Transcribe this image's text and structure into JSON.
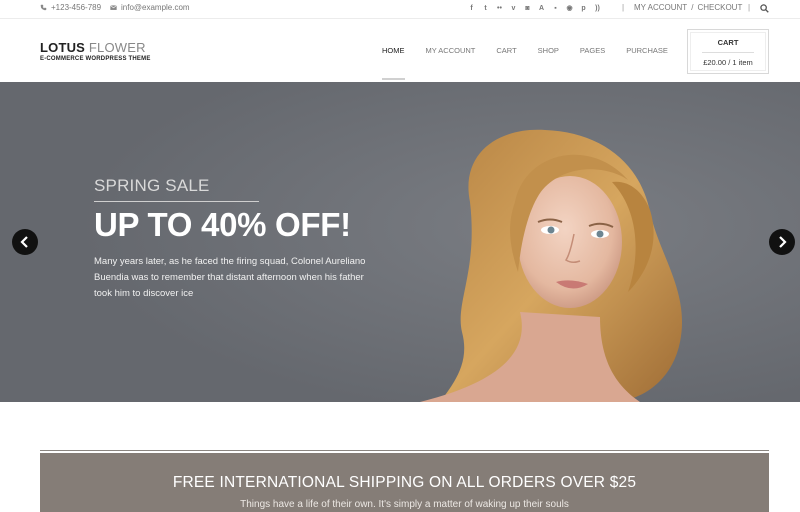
{
  "topbar": {
    "phone": "+123-456-789",
    "email": "info@example.com",
    "socials": [
      "facebook-icon",
      "twitter-icon",
      "flickr-icon",
      "vimeo-icon",
      "instagram-icon",
      "app-icon",
      "delicious-icon",
      "dribbble-icon",
      "pinterest-icon",
      "rss-icon"
    ],
    "my_account": "MY ACCOUNT",
    "slash": "/",
    "checkout": "CHECKOUT"
  },
  "logo": {
    "bold": "LOTUS",
    "thin": "FLOWER",
    "tagline": "E-COMMERCE WORDPRESS THEME"
  },
  "nav": {
    "items": [
      {
        "label": "HOME"
      },
      {
        "label": "MY ACCOUNT"
      },
      {
        "label": "CART"
      },
      {
        "label": "SHOP"
      },
      {
        "label": "PAGES"
      },
      {
        "label": "PURCHASE"
      }
    ],
    "active": "HOME"
  },
  "cart": {
    "title": "CART",
    "value": "£20.00 / 1 item"
  },
  "hero": {
    "eyebrow": "SPRING SALE",
    "headline": "UP TO 40% OFF!",
    "body": "Many years later, as he faced the firing squad, Colonel Aureliano Buendia was to remember that distant afternoon when his father took him to discover ice"
  },
  "promo": {
    "title": "FREE INTERNATIONAL SHIPPING ON ALL ORDERS OVER $25",
    "subtitle": "Things have a life of their own. It's simply a matter of waking up their souls"
  },
  "colors": {
    "hero_bg": "#686b72",
    "promo_bg": "#857d77",
    "hair": "#c9964f"
  }
}
